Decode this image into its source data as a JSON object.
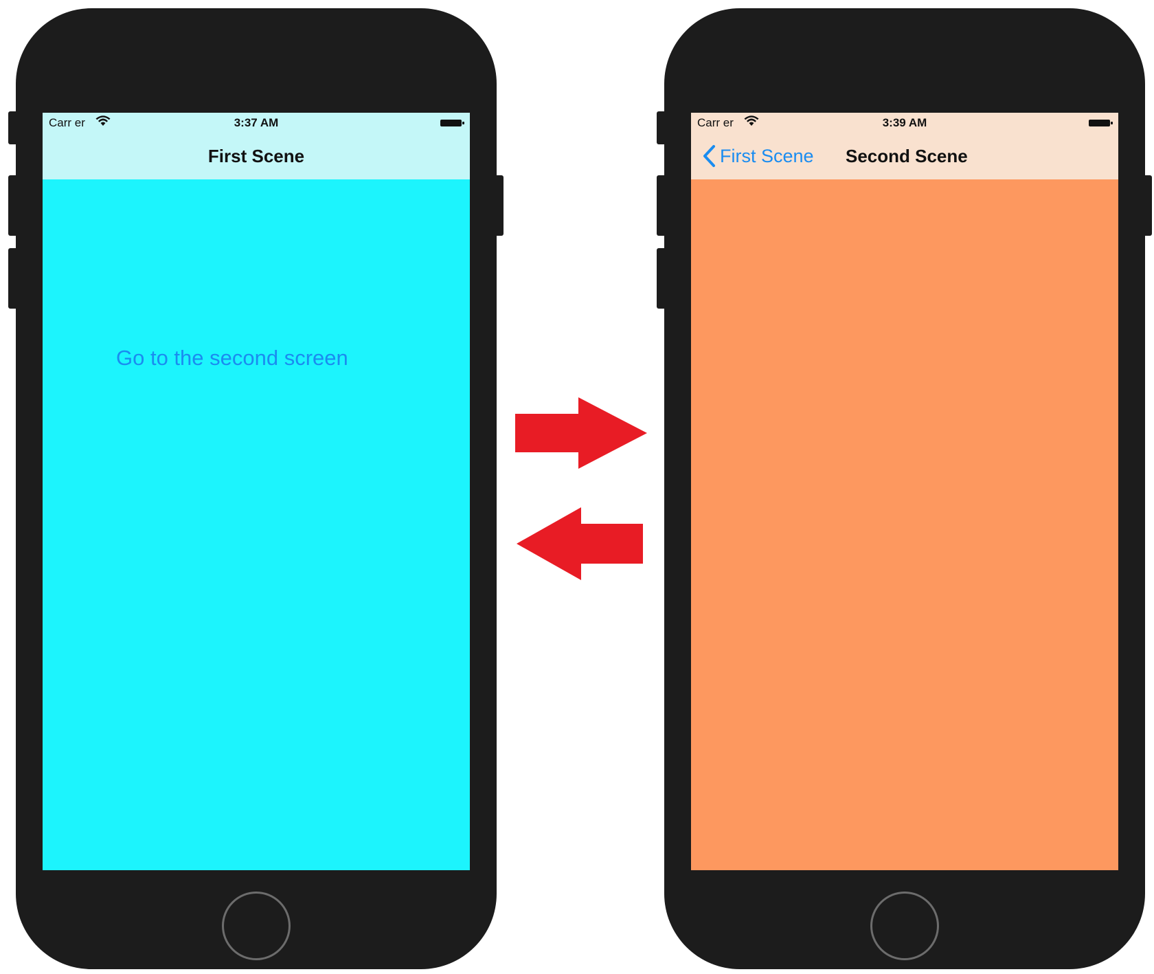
{
  "first_scene": {
    "status": {
      "carrier": "Carr er",
      "time": "3:37 AM"
    },
    "title": "First Scene",
    "button_label": "Go to the second screen",
    "nav_color": "#c4f7f8",
    "bg_color": "#1cf4fd"
  },
  "second_scene": {
    "status": {
      "carrier": "Carr er",
      "time": "3:39 AM"
    },
    "title": "Second Scene",
    "back_label": "First Scene",
    "nav_color": "#f9e1cf",
    "bg_color": "#fd985f"
  },
  "colors": {
    "phone_body": "#1c1c1c",
    "link_blue": "#1a8cf0",
    "arrow_red": "#e81c25"
  },
  "icons": [
    "wifi-icon",
    "battery-icon",
    "back-chevron-icon",
    "arrow-right-icon",
    "arrow-left-icon"
  ]
}
